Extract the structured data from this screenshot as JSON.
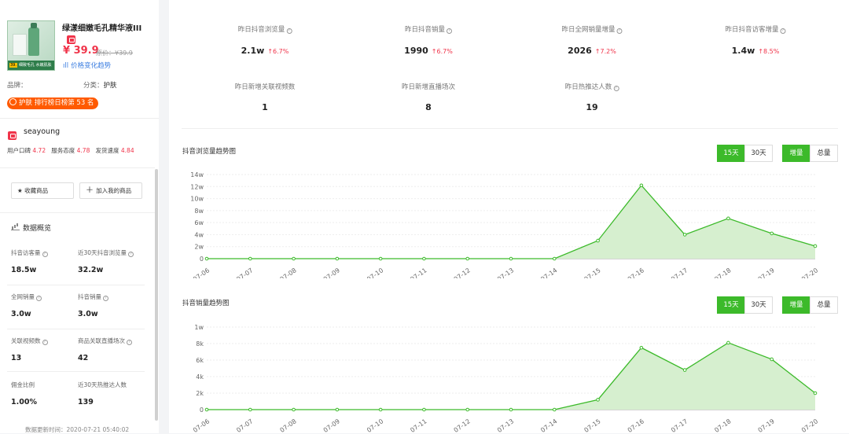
{
  "product": {
    "title": "绿漾细嫩毛孔精华液III",
    "price": "¥ 39.9",
    "original_price": "原价：¥39.9",
    "trend_link": "价格变化趋势",
    "img_strip_badge": "39.",
    "img_strip_text": "细致毛孔 水嫩肌肤",
    "brand_label": "品牌：",
    "category_label": "分类：",
    "category_value": "护肤",
    "rank_badge": "护肤 排行榜日榜第 53 名"
  },
  "shop": {
    "name": "seayoung",
    "score_word_label": "用户口碑",
    "score_word": "4.72",
    "score_service_label": "服务态度",
    "score_service": "4.78",
    "score_ship_label": "发货速度",
    "score_ship": "4.84"
  },
  "actions": {
    "favorite": "收藏商品",
    "add_mine": "加入我的商品"
  },
  "overview": {
    "title": "数据概览",
    "stats": [
      {
        "label": "抖音访客量",
        "value": "18.5w",
        "help": true
      },
      {
        "label": "近30天抖音浏览量",
        "value": "32.2w",
        "help": true
      },
      {
        "label": "全网销量",
        "value": "3.0w",
        "help": true
      },
      {
        "label": "抖音销量",
        "value": "3.0w",
        "help": true
      },
      {
        "label": "关联视频数",
        "value": "13",
        "help": true
      },
      {
        "label": "商品关联直播场次",
        "value": "42",
        "help": true
      },
      {
        "label": "佣金比例",
        "value": "1.00%",
        "help": false
      },
      {
        "label": "近30天热推达人数",
        "value": "139",
        "help": false
      }
    ],
    "updated": "数据更新时间：2020-07-21 05:40:02"
  },
  "summary": [
    {
      "label": "昨日抖音浏览量",
      "value": "2.1w",
      "pct": "↑6.7%",
      "help": true
    },
    {
      "label": "昨日抖音销量",
      "value": "1990",
      "pct": "↑6.7%",
      "help": true
    },
    {
      "label": "昨日全网销量增量",
      "value": "2026",
      "pct": "↑7.2%",
      "help": true
    },
    {
      "label": "昨日抖音访客增量",
      "value": "1.4w",
      "pct": "↑8.5%",
      "help": true
    },
    {
      "label": "昨日新增关联视频数",
      "value": "1",
      "pct": "",
      "help": false
    },
    {
      "label": "昨日新增直播场次",
      "value": "8",
      "pct": "",
      "help": false
    },
    {
      "label": "昨日热推达人数",
      "value": "19",
      "pct": "",
      "help": true
    }
  ],
  "toggles": {
    "d15": "15天",
    "d30": "30天",
    "inc": "增量",
    "total": "总量"
  },
  "colors": {
    "accent": "#3cba2a",
    "red": "#f0344a",
    "fill": "#d6efcf"
  },
  "chart_data": [
    {
      "type": "area",
      "title": "抖音浏览量趋势图",
      "x": [
        "07-06",
        "07-07",
        "07-08",
        "07-09",
        "07-10",
        "07-11",
        "07-12",
        "07-13",
        "07-14",
        "07-15",
        "07-16",
        "07-17",
        "07-18",
        "07-19",
        "07-20"
      ],
      "y_ticks": [
        "0",
        "2w",
        "4w",
        "6w",
        "8w",
        "10w",
        "12w",
        "14w"
      ],
      "ylim": [
        0,
        140000
      ],
      "values": [
        0,
        0,
        0,
        0,
        0,
        0,
        0,
        0,
        0,
        30000,
        122000,
        40000,
        67000,
        42000,
        21000
      ],
      "grid": true
    },
    {
      "type": "area",
      "title": "抖音销量趋势图",
      "x": [
        "07-06",
        "07-07",
        "07-08",
        "07-09",
        "07-10",
        "07-11",
        "07-12",
        "07-13",
        "07-14",
        "07-15",
        "07-16",
        "07-17",
        "07-18",
        "07-19",
        "07-20"
      ],
      "y_ticks": [
        "0",
        "2k",
        "4k",
        "6k",
        "8k",
        "1w"
      ],
      "ylim": [
        0,
        10000
      ],
      "values": [
        0,
        0,
        0,
        0,
        0,
        0,
        0,
        0,
        0,
        1200,
        7500,
        4800,
        8100,
        6100,
        2000
      ],
      "grid": true
    }
  ]
}
